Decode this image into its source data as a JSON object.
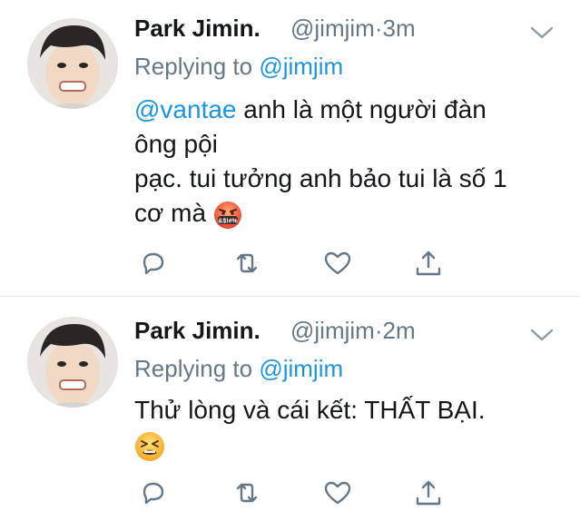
{
  "tweets": [
    {
      "author_name": "Park Jimin.",
      "handle": "@jimjim",
      "time_separator": "·",
      "time": "3m",
      "replying_prefix": "Replying to",
      "replying_to": "@jimjim",
      "mention": "@vantae",
      "lines": [
        "anh là một người đàn",
        "ông pội",
        "pạc. tui tưởng anh bảo tui là số 1",
        "cơ mà"
      ],
      "emoji": "cursing-face-emoji"
    },
    {
      "author_name": "Park Jimin.",
      "handle": "@jimjim",
      "time_separator": "·",
      "time": "2m",
      "replying_prefix": "Replying to",
      "replying_to": "@jimjim",
      "lines": [
        "Thử lòng và cái kết: THẤT BẠI."
      ],
      "emoji": "tired-face-emoji"
    }
  ],
  "actions": [
    "reply-icon",
    "retweet-icon",
    "like-icon",
    "share-icon"
  ],
  "colors": {
    "link": "#1b95e0",
    "secondary_text": "#657786",
    "icon": "#657786",
    "divider": "#e1e8ed"
  }
}
